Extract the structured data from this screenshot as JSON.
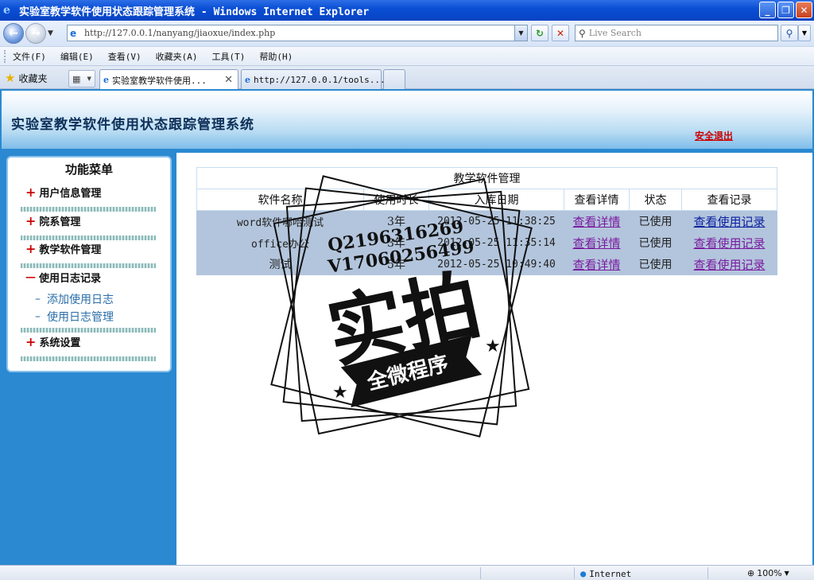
{
  "window": {
    "title": "实验室教学软件使用状态跟踪管理系统 - Windows Internet Explorer",
    "minimize_glyph": "_",
    "maximize_glyph": "❐",
    "close_glyph": "✕"
  },
  "toolbar": {
    "url": "http://127.0.0.1/nanyang/jiaoxue/index.php",
    "search_placeholder": "Live Search"
  },
  "menubar": {
    "items": [
      "文件(F)",
      "编辑(E)",
      "查看(V)",
      "收藏夹(A)",
      "工具(T)",
      "帮助(H)"
    ]
  },
  "tabs": {
    "favorites_label": "收藏夹",
    "items": [
      {
        "label": "实验室教学软件使用..."
      },
      {
        "label": "http://127.0.0.1/tools..."
      }
    ]
  },
  "header": {
    "site_title": "实验室教学软件使用状态跟踪管理系统",
    "logout": "安全退出"
  },
  "sidebar": {
    "title": "功能菜单",
    "groups": [
      {
        "symbol": "+",
        "label": "用户信息管理"
      },
      {
        "symbol": "+",
        "label": "院系管理"
      },
      {
        "symbol": "+",
        "label": "教学软件管理"
      },
      {
        "symbol": "—",
        "label": "使用日志记录",
        "sub": [
          "添加使用日志",
          "使用日志管理"
        ]
      },
      {
        "symbol": "+",
        "label": "系统设置"
      }
    ]
  },
  "table": {
    "caption": "教学软件管理",
    "headers": [
      "软件名称",
      "使用时长",
      "入库日期",
      "查看详情",
      "状态",
      "查看记录"
    ],
    "rows": [
      {
        "name": "word软件哪哈测试",
        "duration": "3年",
        "date": "2012-05-25 11:38:25",
        "detail": "查看详情",
        "status": "已使用",
        "record": "查看使用记录"
      },
      {
        "name": "office办公",
        "duration": "3年",
        "date": "2012-05-25 11:35:14",
        "detail": "查看详情",
        "status": "已使用",
        "record": "查看使用记录"
      },
      {
        "name": "测试",
        "duration": "5年",
        "date": "2012-05-25 10:49:40",
        "detail": "查看详情",
        "status": "已使用",
        "record": "查看使用记录"
      }
    ]
  },
  "watermark": {
    "line1": "Q2196316269",
    "line2": "V17060256499",
    "main": "实拍",
    "banner": "全微程序"
  },
  "statusbar": {
    "zone": "Internet",
    "zoom": "100%"
  },
  "colors": {
    "accent": "#2a89d1",
    "logout_red": "#cc0000",
    "row_highlight": "#b3c5dc"
  }
}
